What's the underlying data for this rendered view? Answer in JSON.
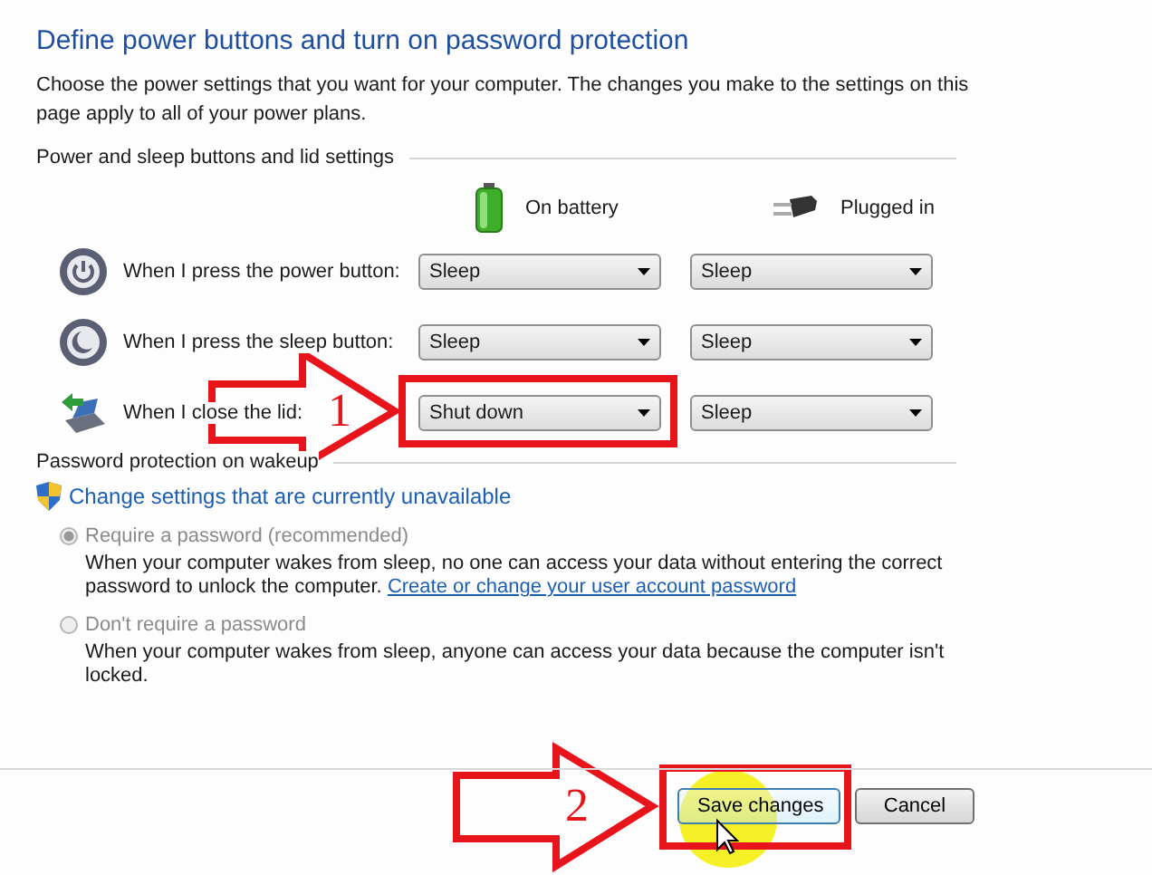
{
  "title": "Define power buttons and turn on password protection",
  "description": "Choose the power settings that you want for your computer. The changes you make to the settings on this page apply to all of your power plans.",
  "buttons_section": {
    "heading": "Power and sleep buttons and lid settings",
    "columns": [
      {
        "kind": "battery",
        "label": "On battery"
      },
      {
        "kind": "plug",
        "label": "Plugged in"
      }
    ],
    "rows": [
      {
        "kind": "power",
        "label": "When I press the power button:",
        "on_battery": "Sleep",
        "plugged_in": "Sleep"
      },
      {
        "kind": "sleep",
        "label": "When I press the sleep button:",
        "on_battery": "Sleep",
        "plugged_in": "Sleep"
      },
      {
        "kind": "lid",
        "label": "When I close the lid:",
        "on_battery": "Shut down",
        "plugged_in": "Sleep"
      }
    ]
  },
  "password_section": {
    "heading": "Password protection on wakeup",
    "link": "Change settings that are currently unavailable",
    "options": [
      {
        "label": "Require a password (recommended)",
        "selected": true,
        "disabled": true,
        "description": "When your computer wakes from sleep, no one can access your data without entering the correct password to unlock the computer.",
        "link": "Create or change your user account password"
      },
      {
        "label": "Don't require a password",
        "selected": false,
        "disabled": true,
        "description": "When your computer wakes from sleep, anyone can access your data because the computer isn't locked."
      }
    ]
  },
  "buttons": [
    {
      "label": "Save changes",
      "kind": "primary"
    },
    {
      "label": "Cancel",
      "kind": "normal"
    }
  ],
  "annotations": [
    {
      "number": "1"
    },
    {
      "number": "2"
    }
  ]
}
